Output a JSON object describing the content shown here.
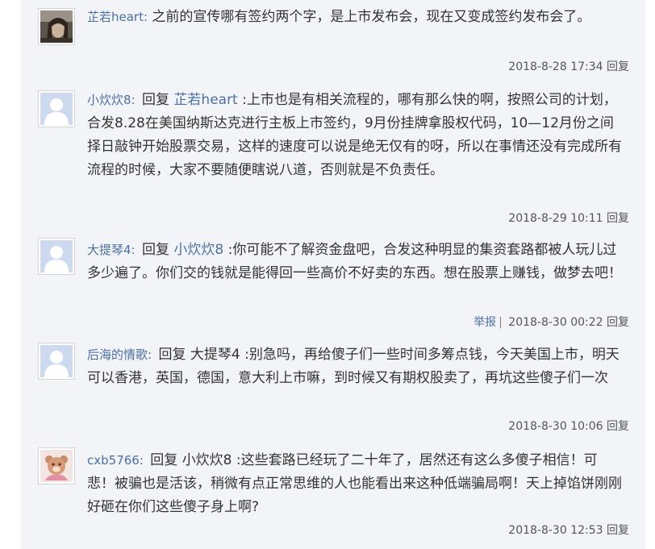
{
  "comments": [
    {
      "user": "芷若heart:",
      "reply_word": "",
      "reply_to": "",
      "text": " 之前的宣传哪有签约两个字，是上市发布会，现在又变成签约发布会了。",
      "time": "2018-8-28 17:34",
      "reply_label": "回复",
      "report_label": ""
    },
    {
      "user": "小炊炊8:",
      "reply_word": "回复",
      "reply_to": "芷若heart",
      "text": " :上市也是有相关流程的，哪有那么快的啊，按照公司的计划，合发8.28在美国纳斯达克进行主板上市签约，9月份挂牌拿股权代码，10—12月份之间择日敲钟开始股票交易，这样的速度可以说是绝无仅有的呀，所以在事情还没有完成所有流程的时候，大家不要随便瞎说八道，否则就是不负责任。",
      "time": "2018-8-29 10:11",
      "reply_label": "回复",
      "report_label": ""
    },
    {
      "user": "大提琴4:",
      "reply_word": "回复",
      "reply_to": "小炊炊8",
      "text": " :你可能不了解资金盘吧，合发这种明显的集资套路都被人玩儿过多少遍了。你们交的钱就是能得回一些高价不好卖的东西。想在股票上赚钱，做梦去吧！",
      "time": "2018-8-30 00:22",
      "reply_label": "回复",
      "report_label": "举报"
    },
    {
      "user": "后海的情歌:",
      "reply_word": "回复",
      "reply_to": "大提琴4",
      "text": " :别急吗，再给傻子们一些时间多筹点钱，今天美国上市，明天可以香港，英国，德国，意大利上市嘛，到时候又有期权股卖了，再坑这些傻子们一次",
      "time": "2018-8-30 10:06",
      "reply_label": "回复",
      "report_label": ""
    },
    {
      "user": "cxb5766:",
      "reply_word": "回复",
      "reply_to": "小炊炊8",
      "text": " :这些套路已经玩了二十年了，居然还有这么多傻子相信！可悲！被骗也是活该，稍微有点正常思维的人也能看出来这种低端骗局啊！天上掉馅饼刚刚好砸在你们这些傻子身上啊?",
      "time": "2018-8-30 12:53",
      "reply_label": "回复",
      "report_label": ""
    }
  ]
}
